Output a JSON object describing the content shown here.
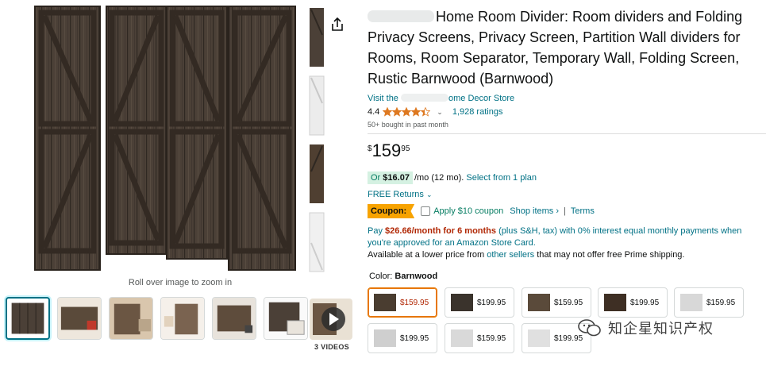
{
  "gallery": {
    "zoom_hint": "Roll over image to zoom in",
    "videos_label": "3 VIDEOS",
    "thumbnails": [
      "divider-dark",
      "divider-room",
      "divider-living",
      "divider-white",
      "divider-office",
      "divider-packaged"
    ]
  },
  "product": {
    "title": "Home Room Divider: Room dividers and Folding Privacy Screens, Privacy Screen, Partition Wall dividers for Rooms, Room Separator, Temporary Wall, Folding Screen, Rustic Barnwood (Barnwood)",
    "title_lines": [
      "Home Room Divider: Room dividers and Folding",
      "Privacy Screens, Privacy Screen, Partition Wall dividers for",
      "Rooms, Room Separator, Temporary Wall, Folding Screen,",
      "Rustic Barnwood (Barnwood)"
    ],
    "store_prefix": "Visit the",
    "store_suffix": "ome Decor Store",
    "rating": "4.4",
    "rating_value": 4.4,
    "ratings_count": "1,928 ratings",
    "bought": "50+ bought in past month"
  },
  "price": {
    "symbol": "$",
    "whole": "159",
    "fraction": "95"
  },
  "offers": {
    "or_label": "Or",
    "monthly_amount": "$16.07",
    "monthly_terms": "/mo (12 mo).",
    "select_plan": "Select from 1 plan",
    "free_returns": "FREE Returns",
    "coupon_tag": "Coupon:",
    "apply_coupon": "Apply $10 coupon",
    "shop_items": "Shop items",
    "terms": "Terms",
    "pay_prefix": "Pay",
    "pay_amount": "$26.66/month for 6 months",
    "pay_rest": "(plus S&H, tax) with 0% interest equal monthly payments when you're approved for an Amazon Store Card.",
    "avail_prefix": "Available at a lower price from",
    "other_sellers": "other sellers",
    "avail_suffix": "that may not offer free Prime shipping."
  },
  "color": {
    "label": "Color:",
    "selected": "Barnwood",
    "options": [
      {
        "price": "$159.95",
        "tone": "#4a3d30"
      },
      {
        "price": "$199.95",
        "tone": "#3a332c"
      },
      {
        "price": "$159.95",
        "tone": "#5a4a3a"
      },
      {
        "price": "$199.95",
        "tone": "#3e2f24"
      },
      {
        "price": "$159.95",
        "tone": "#d8d8d8"
      },
      {
        "price": "$199.95",
        "tone": "#cfcfcf"
      },
      {
        "price": "$159.95",
        "tone": "#d9d9d9"
      },
      {
        "price": "$199.95",
        "tone": "#e0e0e0"
      }
    ]
  },
  "watermark": {
    "text": "知企星知识产权"
  },
  "colors": {
    "link": "#007185",
    "price_red": "#b12704",
    "star": "#de7921",
    "coupon": "#f7a300"
  }
}
